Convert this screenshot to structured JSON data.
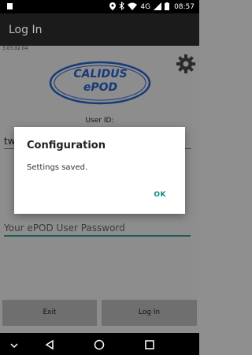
{
  "status_bar": {
    "time": "08:57",
    "network": "4G",
    "icons": [
      "location-icon",
      "bluetooth-icon",
      "wifi-icon",
      "signal-icon",
      "battery-icon"
    ]
  },
  "app_bar": {
    "title": "Log In"
  },
  "main": {
    "version": "3.03.02.04",
    "logo_line1": "CALIDUS",
    "logo_line2": "ePOD",
    "user_id_label": "User ID:",
    "user_id_value": "tw",
    "password_placeholder": "Your ePOD User Password",
    "exit_label": "Exit",
    "login_label": "Log In"
  },
  "dialog": {
    "title": "Configuration",
    "message": "Settings saved.",
    "ok_label": "OK"
  },
  "colors": {
    "accent": "#0b8a78",
    "dim_overlay": "#8d8d8d",
    "logo_blue": "#173a78"
  }
}
